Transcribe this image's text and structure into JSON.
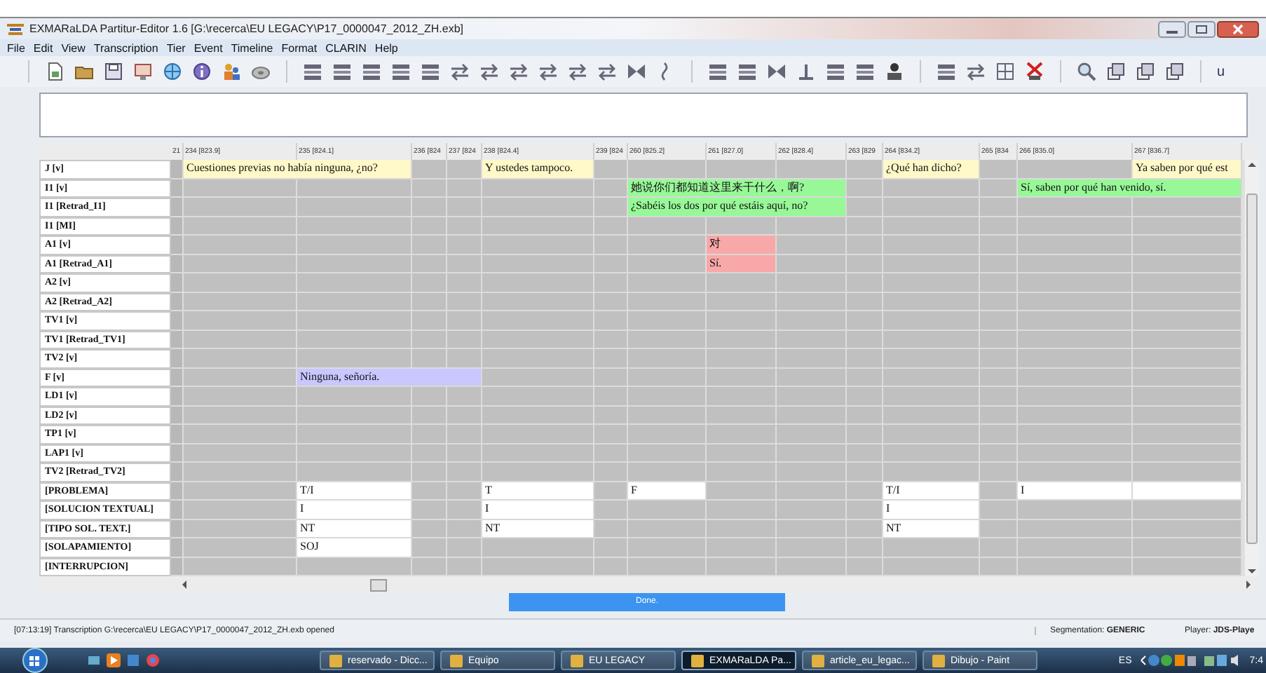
{
  "window": {
    "title": "EXMARaLDA Partitur-Editor 1.6 [G:\\recerca\\EU LEGACY\\P17_0000047_2012_ZH.exb]"
  },
  "menu": [
    "File",
    "Edit",
    "View",
    "Transcription",
    "Tier",
    "Event",
    "Timeline",
    "Format",
    "CLARIN",
    "Help"
  ],
  "toolbar": {
    "text_button": "u"
  },
  "timeline": [
    {
      "label": "21"
    },
    {
      "label": "234 [823.9]"
    },
    {
      "label": "235 [824.1]"
    },
    {
      "label": "236 [824"
    },
    {
      "label": "237 [824"
    },
    {
      "label": "238 [824.4]"
    },
    {
      "label": "239 [824"
    },
    {
      "label": "260 [825.2]"
    },
    {
      "label": "261 [827.0]"
    },
    {
      "label": "262 [828.4]"
    },
    {
      "label": "263 [829"
    },
    {
      "label": "264 [834.2]"
    },
    {
      "label": "265 [834"
    },
    {
      "label": "266 [835.0]"
    },
    {
      "label": "267 [836.7]"
    }
  ],
  "tiers": [
    {
      "label": "J [v]",
      "cells": [
        {
          "kind": "empty"
        },
        {
          "kind": "event",
          "text": "Cuestiones previas no había ninguna, ¿no?",
          "color": "#fff8c8"
        },
        {
          "kind": "continued"
        },
        {
          "kind": "empty"
        },
        {
          "kind": "empty"
        },
        {
          "kind": "event",
          "text": "Y ustedes tampoco.",
          "color": "#fff8c8"
        },
        {
          "kind": "empty"
        },
        {
          "kind": "empty"
        },
        {
          "kind": "empty"
        },
        {
          "kind": "empty"
        },
        {
          "kind": "empty"
        },
        {
          "kind": "event",
          "text": "¿Qué han dicho?",
          "color": "#fff8c8"
        },
        {
          "kind": "empty"
        },
        {
          "kind": "empty"
        },
        {
          "kind": "event",
          "text": "Ya saben por qué est",
          "color": "#fff8c8"
        }
      ]
    },
    {
      "label": "I1 [v]",
      "cells": [
        {
          "kind": "empty"
        },
        {
          "kind": "empty"
        },
        {
          "kind": "empty"
        },
        {
          "kind": "empty"
        },
        {
          "kind": "empty"
        },
        {
          "kind": "empty"
        },
        {
          "kind": "empty"
        },
        {
          "kind": "event",
          "text": "她说你们都知道这里来干什么，啊?",
          "color": "#98f898"
        },
        {
          "kind": "continued"
        },
        {
          "kind": "continued"
        },
        {
          "kind": "empty"
        },
        {
          "kind": "empty"
        },
        {
          "kind": "empty"
        },
        {
          "kind": "event",
          "text": "Sí, saben por qué han venido, sí.",
          "color": "#98f898"
        },
        {
          "kind": "continued"
        }
      ]
    },
    {
      "label": "I1 [Retrad_I1]",
      "cells": [
        {
          "kind": "empty"
        },
        {
          "kind": "empty"
        },
        {
          "kind": "empty"
        },
        {
          "kind": "empty"
        },
        {
          "kind": "empty"
        },
        {
          "kind": "empty"
        },
        {
          "kind": "empty"
        },
        {
          "kind": "event",
          "text": "¿Sabéis los dos por qué estáis aquí, no?",
          "color": "#98f898"
        },
        {
          "kind": "continued"
        },
        {
          "kind": "continued"
        },
        {
          "kind": "empty"
        },
        {
          "kind": "empty"
        },
        {
          "kind": "empty"
        },
        {
          "kind": "empty"
        },
        {
          "kind": "empty"
        }
      ]
    },
    {
      "label": "I1 [MI]"
    },
    {
      "label": "A1 [v]",
      "cells": [
        {
          "kind": "empty"
        },
        {
          "kind": "empty"
        },
        {
          "kind": "empty"
        },
        {
          "kind": "empty"
        },
        {
          "kind": "empty"
        },
        {
          "kind": "empty"
        },
        {
          "kind": "empty"
        },
        {
          "kind": "empty"
        },
        {
          "kind": "event",
          "text": "对",
          "color": "#f8a8a8"
        },
        {
          "kind": "empty"
        },
        {
          "kind": "empty"
        },
        {
          "kind": "empty"
        },
        {
          "kind": "empty"
        },
        {
          "kind": "empty"
        },
        {
          "kind": "empty"
        }
      ]
    },
    {
      "label": "A1 [Retrad_A1]",
      "cells": [
        {
          "kind": "empty"
        },
        {
          "kind": "empty"
        },
        {
          "kind": "empty"
        },
        {
          "kind": "empty"
        },
        {
          "kind": "empty"
        },
        {
          "kind": "empty"
        },
        {
          "kind": "empty"
        },
        {
          "kind": "empty"
        },
        {
          "kind": "event",
          "text": "Sí.",
          "color": "#f8a8a8"
        },
        {
          "kind": "empty"
        },
        {
          "kind": "empty"
        },
        {
          "kind": "empty"
        },
        {
          "kind": "empty"
        },
        {
          "kind": "empty"
        },
        {
          "kind": "empty"
        }
      ]
    },
    {
      "label": "A2 [v]"
    },
    {
      "label": "A2 [Retrad_A2]"
    },
    {
      "label": "TV1 [v]"
    },
    {
      "label": "TV1 [Retrad_TV1]"
    },
    {
      "label": "TV2 [v]"
    },
    {
      "label": "F [v]",
      "cells": [
        {
          "kind": "empty"
        },
        {
          "kind": "empty"
        },
        {
          "kind": "event",
          "text": "Ninguna, señoría.",
          "color": "#c8c8ff"
        },
        {
          "kind": "continued"
        },
        {
          "kind": "continued"
        },
        {
          "kind": "empty"
        },
        {
          "kind": "empty"
        },
        {
          "kind": "empty"
        },
        {
          "kind": "empty"
        },
        {
          "kind": "empty"
        },
        {
          "kind": "empty"
        },
        {
          "kind": "empty"
        },
        {
          "kind": "empty"
        },
        {
          "kind": "empty"
        },
        {
          "kind": "empty"
        }
      ]
    },
    {
      "label": "LD1 [v]"
    },
    {
      "label": "LD2 [v]"
    },
    {
      "label": "TP1 [v]"
    },
    {
      "label": "LAP1 [v]"
    },
    {
      "label": "TV2 [Retrad_TV2]"
    },
    {
      "label": "[PROBLEMA]",
      "cells": [
        {
          "kind": "empty"
        },
        {
          "kind": "empty"
        },
        {
          "kind": "event",
          "text": "T/I",
          "color": "#ffffff"
        },
        {
          "kind": "empty"
        },
        {
          "kind": "empty"
        },
        {
          "kind": "event",
          "text": "T",
          "color": "#ffffff"
        },
        {
          "kind": "empty"
        },
        {
          "kind": "event",
          "text": "F",
          "color": "#ffffff"
        },
        {
          "kind": "empty"
        },
        {
          "kind": "empty"
        },
        {
          "kind": "empty"
        },
        {
          "kind": "event",
          "text": "T/I",
          "color": "#ffffff"
        },
        {
          "kind": "empty"
        },
        {
          "kind": "event",
          "text": "I",
          "color": "#ffffff"
        },
        {
          "kind": "event",
          "color": "#ffffff"
        }
      ]
    },
    {
      "label": "[SOLUCION TEXTUAL]",
      "cells": [
        {
          "kind": "empty"
        },
        {
          "kind": "empty"
        },
        {
          "kind": "event",
          "text": "I",
          "color": "#ffffff"
        },
        {
          "kind": "empty"
        },
        {
          "kind": "empty"
        },
        {
          "kind": "event",
          "text": "I",
          "color": "#ffffff"
        },
        {
          "kind": "empty"
        },
        {
          "kind": "empty"
        },
        {
          "kind": "empty"
        },
        {
          "kind": "empty"
        },
        {
          "kind": "empty"
        },
        {
          "kind": "event",
          "text": "I",
          "color": "#ffffff"
        },
        {
          "kind": "empty"
        },
        {
          "kind": "empty"
        },
        {
          "kind": "empty"
        }
      ]
    },
    {
      "label": "[TIPO SOL. TEXT.]",
      "cells": [
        {
          "kind": "empty"
        },
        {
          "kind": "empty"
        },
        {
          "kind": "event",
          "text": "NT",
          "color": "#ffffff"
        },
        {
          "kind": "empty"
        },
        {
          "kind": "empty"
        },
        {
          "kind": "event",
          "text": "NT",
          "color": "#ffffff"
        },
        {
          "kind": "empty"
        },
        {
          "kind": "empty"
        },
        {
          "kind": "empty"
        },
        {
          "kind": "empty"
        },
        {
          "kind": "empty"
        },
        {
          "kind": "event",
          "text": "NT",
          "color": "#ffffff"
        },
        {
          "kind": "empty"
        },
        {
          "kind": "empty"
        },
        {
          "kind": "empty"
        }
      ]
    },
    {
      "label": "[SOLAPAMIENTO]",
      "cells": [
        {
          "kind": "empty"
        },
        {
          "kind": "empty"
        },
        {
          "kind": "event",
          "text": "SOJ",
          "color": "#ffffff"
        },
        {
          "kind": "empty"
        },
        {
          "kind": "empty"
        },
        {
          "kind": "empty"
        },
        {
          "kind": "empty"
        },
        {
          "kind": "empty"
        },
        {
          "kind": "empty"
        },
        {
          "kind": "empty"
        },
        {
          "kind": "empty"
        },
        {
          "kind": "empty"
        },
        {
          "kind": "empty"
        },
        {
          "kind": "empty"
        },
        {
          "kind": "empty"
        }
      ]
    },
    {
      "label": "[INTERRUPCION]"
    }
  ],
  "progress": {
    "text": "Done.",
    "level": 1
  },
  "status_bar": {
    "message": "[07:13:19] Transcription G:\\recerca\\EU LEGACY\\P17_0000047_2012_ZH.exb opened",
    "segmentation": "Segmentation: **GENERIC**",
    "player": "Player: **JDS-Playe**"
  },
  "taskbar": {
    "tasks": [
      {
        "label": "reservado - Dicc...",
        "selected": false
      },
      {
        "label": "Equipo",
        "selected": false
      },
      {
        "label": "EU LEGACY",
        "selected": false
      },
      {
        "label": "EXMARaLDA Pa...",
        "selected": true
      },
      {
        "label": "article_eu_legac...",
        "selected": false
      },
      {
        "label": "Dibujo - Paint",
        "selected": false
      }
    ],
    "language": "ES",
    "clock": "7:4"
  }
}
